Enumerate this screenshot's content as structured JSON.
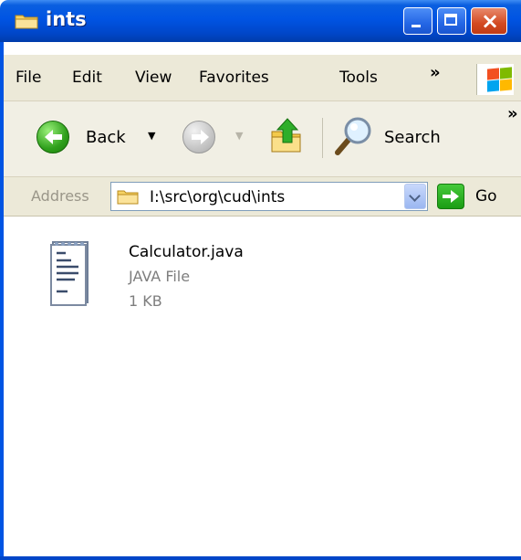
{
  "window": {
    "title": "ints"
  },
  "menu": {
    "items": [
      "File",
      "Edit",
      "View",
      "Favorites",
      "Tools"
    ],
    "more": "»"
  },
  "toolbar": {
    "back_label": "Back",
    "search_label": "Search",
    "more": "»"
  },
  "address": {
    "label": "Address",
    "value": "I:\\src\\org\\cud\\ints",
    "go_label": "Go"
  },
  "files": [
    {
      "name": "Calculator.java",
      "type": "JAVA File",
      "size": "1 KB"
    }
  ],
  "icons": {
    "title": "folder-icon",
    "back": "arrow-left-icon",
    "forward": "arrow-right-icon",
    "up": "folder-up-icon",
    "search": "magnifier-icon",
    "go": "arrow-right-icon",
    "file": "text-document-icon"
  },
  "colors": {
    "titlebar": "#0054e3",
    "menubar": "#ece9d8",
    "close_button": "#d34a22",
    "go_button": "#1b9d14"
  }
}
